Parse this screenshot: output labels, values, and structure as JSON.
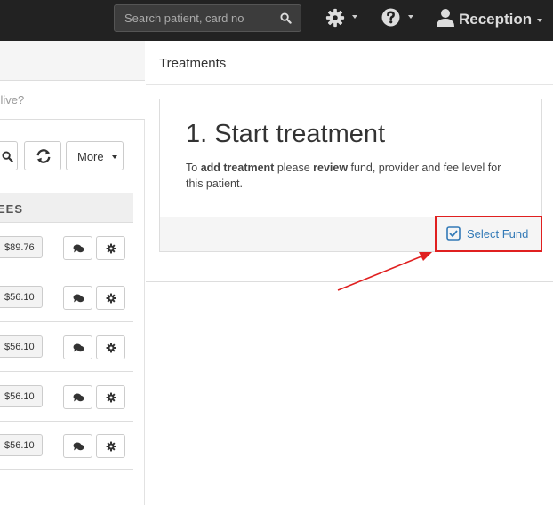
{
  "navbar": {
    "search_placeholder": "Search patient, card no",
    "icons": [
      "search-icon",
      "gear-icon",
      "help-icon",
      "user-icon"
    ],
    "user_label": "Reception"
  },
  "left": {
    "question": "nt live?",
    "more_label": "More",
    "fees_header": "EES",
    "rows": [
      {
        "price": "$89.76"
      },
      {
        "price": "$56.10"
      },
      {
        "price": "$56.10"
      },
      {
        "price": "$56.10"
      },
      {
        "price": "$56.10"
      }
    ]
  },
  "main": {
    "header": "Treatments",
    "panel": {
      "title": "1. Start treatment",
      "text_prefix": "To ",
      "text_bold1": "add treatment",
      "text_mid": " please ",
      "text_bold2": "review",
      "text_suffix": " fund, provider and fee level for this patient.",
      "select_fund_label": "Select Fund"
    }
  },
  "colors": {
    "navbar": "#222222",
    "link": "#337ab7",
    "highlight": "#e02020",
    "panel_accent": "#5bc0de"
  }
}
